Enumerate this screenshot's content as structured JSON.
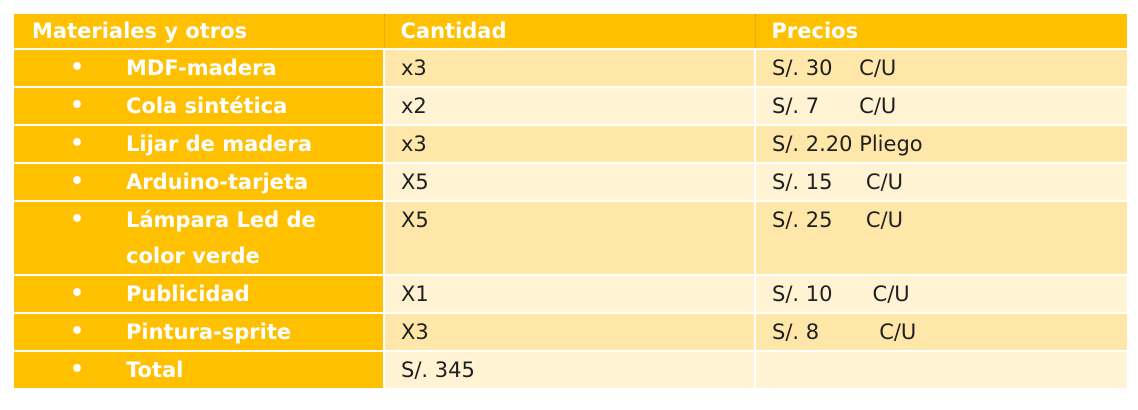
{
  "headers": {
    "materials": "Materiales y otros",
    "quantity": "Cantidad",
    "prices": "Precios"
  },
  "bullet_glyph": "•",
  "rows": [
    {
      "item": "MDF-madera",
      "quantity": "x3",
      "price": "S/. 30    C/U"
    },
    {
      "item": "Cola sintética",
      "quantity": "x2",
      "price": "S/. 7      C/U"
    },
    {
      "item": "Lijar de madera",
      "quantity": "x3",
      "price": "S/. 2.20 Pliego"
    },
    {
      "item": "Arduino-tarjeta",
      "quantity": "X5",
      "price": "S/. 15     C/U"
    },
    {
      "item": "Lámpara Led de\ncolor verde",
      "quantity": "X5",
      "price": "S/. 25     C/U"
    },
    {
      "item": "Publicidad",
      "quantity": "X1",
      "price": "S/. 10      C/U"
    },
    {
      "item": "Pintura-sprite",
      "quantity": "X3",
      "price": "S/. 8         C/U"
    },
    {
      "item": "Total",
      "quantity": "S/. 345",
      "price": ""
    }
  ],
  "colors": {
    "header_bg": "#ffc000",
    "item_col_bg": "#ffc000",
    "band_dark": "#ffe7a9",
    "band_light": "#fff3d3",
    "header_text": "#ffffff",
    "body_text": "#1f1f1f"
  }
}
